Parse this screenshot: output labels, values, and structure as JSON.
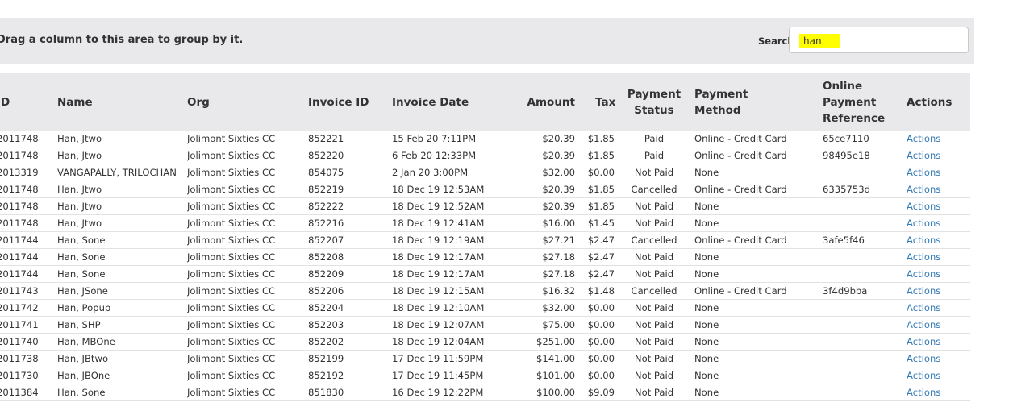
{
  "toolbar": {
    "group_hint": "Drag a column to this area to group by it.",
    "search_label": "Search",
    "search_value": "han"
  },
  "columns": {
    "id": "ID",
    "name": "Name",
    "org": "Org",
    "invoice_id": "Invoice ID",
    "invoice_date": "Invoice Date",
    "amount": "Amount",
    "tax": "Tax",
    "payment_status": "Payment Status",
    "payment_method": "Payment Method",
    "online_ref": "Online Payment Reference",
    "actions": "Actions"
  },
  "rows": [
    {
      "id": "2011748",
      "name": "Han, Jtwo",
      "org": "Jolimont Sixties CC",
      "invoice_id": "852221",
      "invoice_date": "15 Feb 20 7:11PM",
      "amount": "$20.39",
      "tax": "$1.85",
      "status": "Paid",
      "method": "Online - Credit Card",
      "ref": "65ce7110",
      "action": "Actions"
    },
    {
      "id": "2011748",
      "name": "Han, Jtwo",
      "org": "Jolimont Sixties CC",
      "invoice_id": "852220",
      "invoice_date": "6 Feb 20 12:33PM",
      "amount": "$20.39",
      "tax": "$1.85",
      "status": "Paid",
      "method": "Online - Credit Card",
      "ref": "98495e18",
      "action": "Actions"
    },
    {
      "id": "2013319",
      "name": "VANGAPALLY, TRILOCHAN",
      "org": "Jolimont Sixties CC",
      "invoice_id": "854075",
      "invoice_date": "2 Jan 20 3:00PM",
      "amount": "$32.00",
      "tax": "$0.00",
      "status": "Not Paid",
      "method": "None",
      "ref": "",
      "action": "Actions"
    },
    {
      "id": "2011748",
      "name": "Han, Jtwo",
      "org": "Jolimont Sixties CC",
      "invoice_id": "852219",
      "invoice_date": "18 Dec 19 12:53AM",
      "amount": "$20.39",
      "tax": "$1.85",
      "status": "Cancelled",
      "method": "Online - Credit Card",
      "ref": "6335753d",
      "action": "Actions"
    },
    {
      "id": "2011748",
      "name": "Han, Jtwo",
      "org": "Jolimont Sixties CC",
      "invoice_id": "852222",
      "invoice_date": "18 Dec 19 12:52AM",
      "amount": "$20.39",
      "tax": "$1.85",
      "status": "Not Paid",
      "method": "None",
      "ref": "",
      "action": "Actions"
    },
    {
      "id": "2011748",
      "name": "Han, Jtwo",
      "org": "Jolimont Sixties CC",
      "invoice_id": "852216",
      "invoice_date": "18 Dec 19 12:41AM",
      "amount": "$16.00",
      "tax": "$1.45",
      "status": "Not Paid",
      "method": "None",
      "ref": "",
      "action": "Actions"
    },
    {
      "id": "2011744",
      "name": "Han, Sone",
      "org": "Jolimont Sixties CC",
      "invoice_id": "852207",
      "invoice_date": "18 Dec 19 12:19AM",
      "amount": "$27.21",
      "tax": "$2.47",
      "status": "Cancelled",
      "method": "Online - Credit Card",
      "ref": "3afe5f46",
      "action": "Actions"
    },
    {
      "id": "2011744",
      "name": "Han, Sone",
      "org": "Jolimont Sixties CC",
      "invoice_id": "852208",
      "invoice_date": "18 Dec 19 12:17AM",
      "amount": "$27.18",
      "tax": "$2.47",
      "status": "Not Paid",
      "method": "None",
      "ref": "",
      "action": "Actions"
    },
    {
      "id": "2011744",
      "name": "Han, Sone",
      "org": "Jolimont Sixties CC",
      "invoice_id": "852209",
      "invoice_date": "18 Dec 19 12:17AM",
      "amount": "$27.18",
      "tax": "$2.47",
      "status": "Not Paid",
      "method": "None",
      "ref": "",
      "action": "Actions"
    },
    {
      "id": "2011743",
      "name": "Han, JSone",
      "org": "Jolimont Sixties CC",
      "invoice_id": "852206",
      "invoice_date": "18 Dec 19 12:15AM",
      "amount": "$16.32",
      "tax": "$1.48",
      "status": "Cancelled",
      "method": "Online - Credit Card",
      "ref": "3f4d9bba",
      "action": "Actions"
    },
    {
      "id": "2011742",
      "name": "Han, Popup",
      "org": "Jolimont Sixties CC",
      "invoice_id": "852204",
      "invoice_date": "18 Dec 19 12:10AM",
      "amount": "$32.00",
      "tax": "$0.00",
      "status": "Not Paid",
      "method": "None",
      "ref": "",
      "action": "Actions"
    },
    {
      "id": "2011741",
      "name": "Han, SHP",
      "org": "Jolimont Sixties CC",
      "invoice_id": "852203",
      "invoice_date": "18 Dec 19 12:07AM",
      "amount": "$75.00",
      "tax": "$0.00",
      "status": "Not Paid",
      "method": "None",
      "ref": "",
      "action": "Actions"
    },
    {
      "id": "2011740",
      "name": "Han, MBOne",
      "org": "Jolimont Sixties CC",
      "invoice_id": "852202",
      "invoice_date": "18 Dec 19 12:04AM",
      "amount": "$251.00",
      "tax": "$0.00",
      "status": "Not Paid",
      "method": "None",
      "ref": "",
      "action": "Actions"
    },
    {
      "id": "2011738",
      "name": "Han, JBtwo",
      "org": "Jolimont Sixties CC",
      "invoice_id": "852199",
      "invoice_date": "17 Dec 19 11:59PM",
      "amount": "$141.00",
      "tax": "$0.00",
      "status": "Not Paid",
      "method": "None",
      "ref": "",
      "action": "Actions"
    },
    {
      "id": "2011730",
      "name": "Han, JBOne",
      "org": "Jolimont Sixties CC",
      "invoice_id": "852192",
      "invoice_date": "17 Dec 19 11:45PM",
      "amount": "$101.00",
      "tax": "$0.00",
      "status": "Not Paid",
      "method": "None",
      "ref": "",
      "action": "Actions"
    },
    {
      "id": "2011384",
      "name": "Han, Sone",
      "org": "Jolimont Sixties CC",
      "invoice_id": "851830",
      "invoice_date": "16 Dec 19 12:22PM",
      "amount": "$100.00",
      "tax": "$9.09",
      "status": "Not Paid",
      "method": "None",
      "ref": "",
      "action": "Actions"
    }
  ],
  "colors": {
    "header_bg": "#e9e9eb",
    "link": "#337ab7",
    "search_highlight": "#ffff00"
  }
}
